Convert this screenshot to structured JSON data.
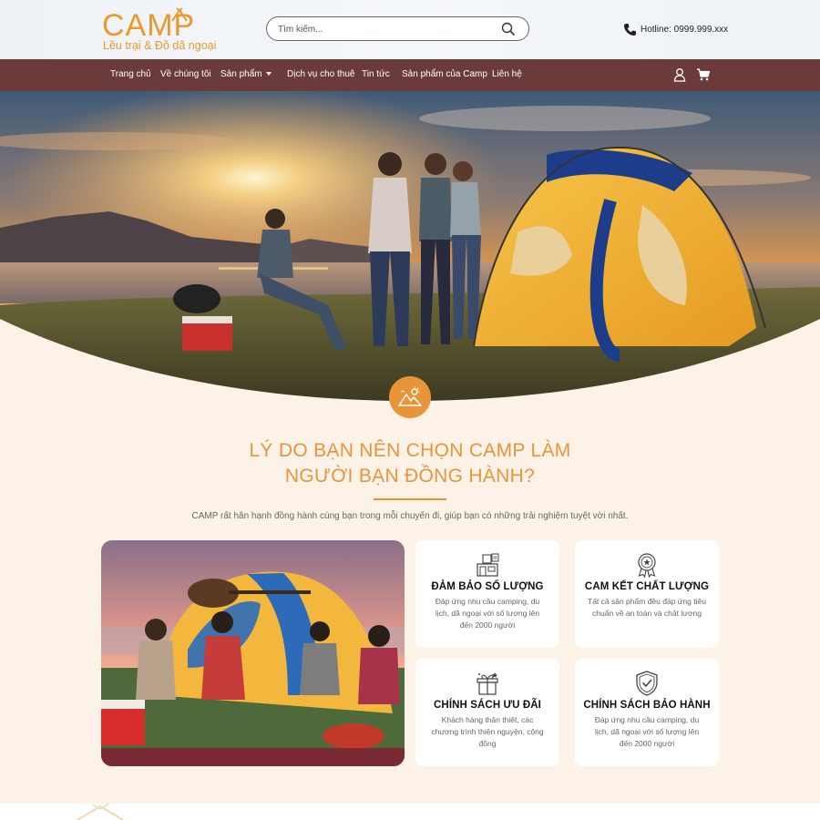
{
  "header": {
    "logo_text": "CAMP",
    "logo_tagline": "Lều trại & Đồ dã ngoại",
    "search_placeholder": "Tìm kiếm...",
    "hotline": "Hotline: 0999.999.xxx"
  },
  "nav": {
    "items": [
      {
        "label": "Trang chủ"
      },
      {
        "label": "Về chúng tôi"
      },
      {
        "label": "Sản phẩm"
      },
      {
        "label": "Dịch vụ cho thuê"
      },
      {
        "label": "Tin tức"
      },
      {
        "label": "Sản phẩm của Camp"
      },
      {
        "label": "Liên hệ"
      }
    ],
    "icons": [
      "user-icon",
      "cart-icon"
    ]
  },
  "hero": {
    "icon": "mountain-sun-icon"
  },
  "reason": {
    "title_line1": "LÝ DO BẠN NÊN CHỌN CAMP LÀM",
    "title_line2": "NGƯỜI BẠN ĐỒNG HÀNH?",
    "subtitle": "CAMP rất hân hạnh đồng hành cùng bạn trong mỗi chuyến đi, giúp bạn có những trải nghiệm tuyệt vời nhất.",
    "cards": [
      {
        "icon": "warehouse-icon",
        "title": "ĐẢM BẢO SỐ LƯỢNG",
        "desc": "Đáp ứng nhu cầu camping, du lịch, dã ngoại với số lượng lên đến 2000 người"
      },
      {
        "icon": "quality-medal-icon",
        "title": "CAM KẾT CHẤT LƯỢNG",
        "desc": "Tất cả sản phẩm đều đáp ứng tiêu chuẩn về an toàn và chất lượng"
      },
      {
        "icon": "gift-icon",
        "title": "CHÍNH SÁCH ƯU ĐÃI",
        "desc": "Khách hàng thân thiết, các chương trình thiện nguyện, cộng đồng"
      },
      {
        "icon": "shield-check-icon",
        "title": "CHÍNH SÁCH BẢO HÀNH",
        "desc": "Đáp ứng nhu cầu camping, du lịch, dã ngoại với số lượng lên đến 2000 người"
      }
    ]
  },
  "colors": {
    "accent": "#e8953a",
    "nav_bg": "#6b3b3b",
    "page_bg": "#fdf2e7"
  }
}
